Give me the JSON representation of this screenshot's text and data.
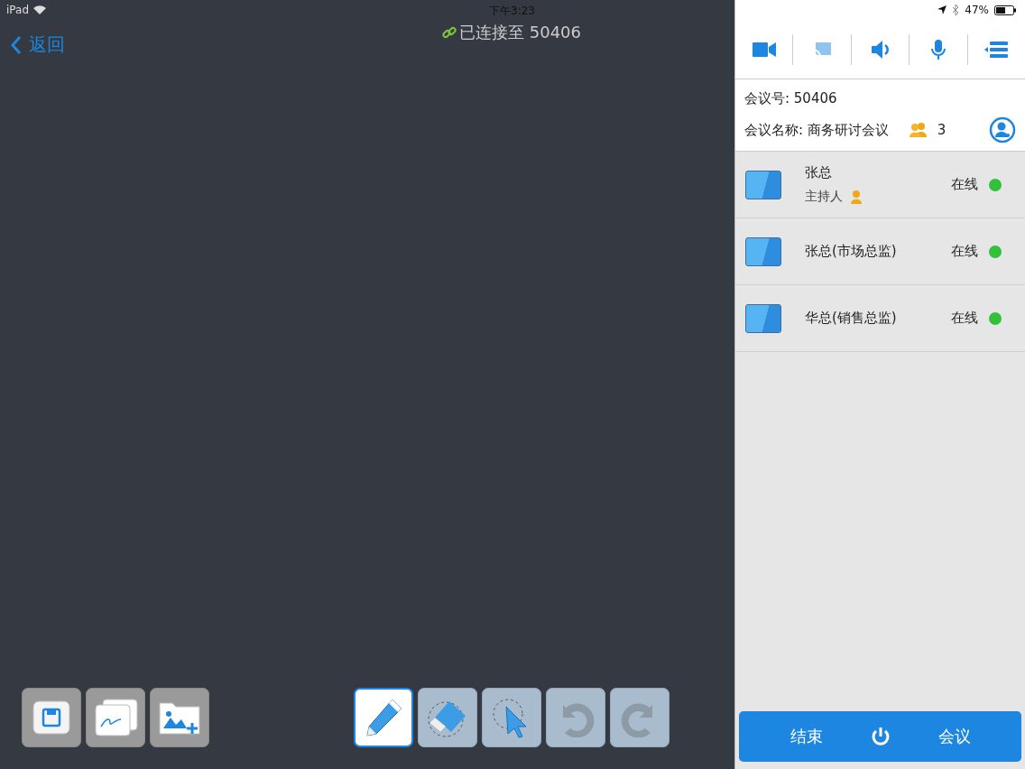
{
  "status_bar": {
    "device": "iPad",
    "time": "下午3:23",
    "battery": "47%"
  },
  "whiteboard": {
    "back": "返回",
    "connection": "已连接至 50406",
    "file_tools": [
      {
        "kind": "save"
      },
      {
        "kind": "pages"
      },
      {
        "kind": "image"
      }
    ],
    "draw_tools": [
      {
        "kind": "pencil",
        "selected": true
      },
      {
        "kind": "eraser",
        "selected": false
      },
      {
        "kind": "select",
        "selected": false
      },
      {
        "kind": "undo",
        "selected": false
      },
      {
        "kind": "redo",
        "selected": false
      }
    ]
  },
  "panel": {
    "toolbar": [
      {
        "kind": "camera"
      },
      {
        "kind": "cast"
      },
      {
        "kind": "speaker"
      },
      {
        "kind": "mic"
      },
      {
        "kind": "list"
      }
    ],
    "meeting_id": "会议号: 50406",
    "meeting_name": "会议名称: 商务研讨会议",
    "participant_count": "3",
    "participants": [
      {
        "name": "张总",
        "role": "主持人",
        "status": "在线",
        "color": "#33c13c"
      },
      {
        "name": "张总(市场总监)",
        "status": "在线",
        "color": "#33c13c"
      },
      {
        "name": "华总(销售总监)",
        "status": "在线",
        "color": "#33c13c"
      }
    ],
    "end_button": {
      "left": "结束",
      "right": "会议"
    }
  }
}
